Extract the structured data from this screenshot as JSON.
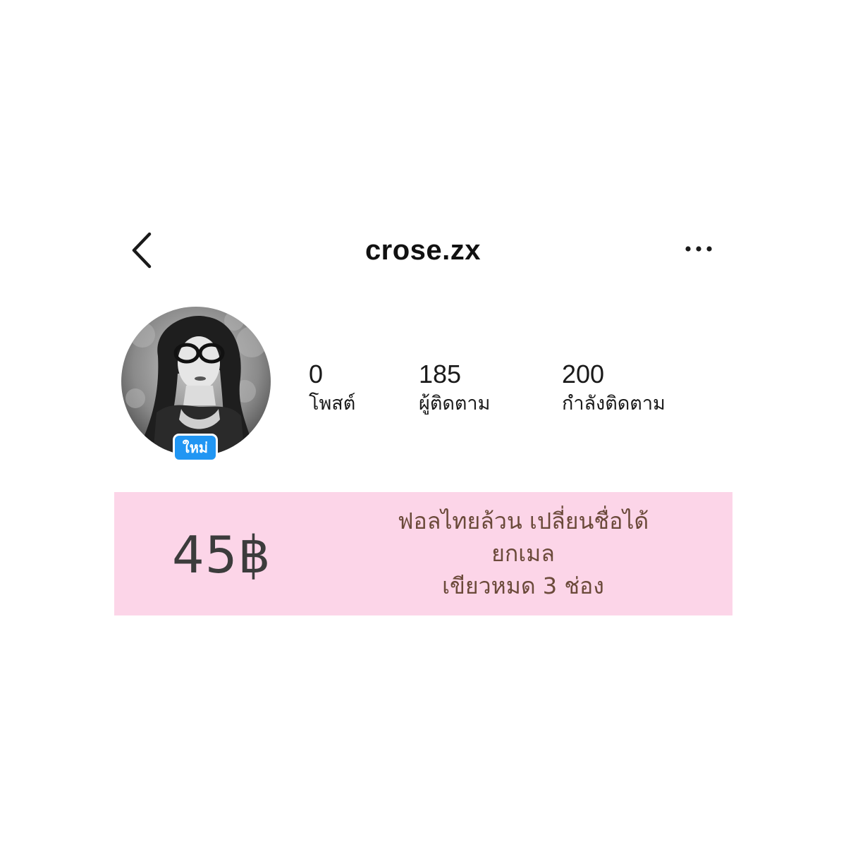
{
  "header": {
    "username": "crose.zx"
  },
  "profile": {
    "badge": "ใหม่",
    "stats": [
      {
        "value": "0",
        "label": "โพสต์"
      },
      {
        "value": "185",
        "label": "ผู้ติดตาม"
      },
      {
        "value": "200",
        "label": "กำลังติดตาม"
      }
    ]
  },
  "promo": {
    "price": "45฿",
    "lines": [
      "ฟอลไทยล้วน เปลี่ยนชื่อได้",
      "ยกเมล",
      "เขียวหมด 3 ช่อง"
    ],
    "background_color": "#fcd5e8"
  },
  "colors": {
    "badge": "#2196f3",
    "text": "#111111",
    "promo_text": "#6b4a3a"
  },
  "icons": {
    "back": "chevron-left-icon",
    "more": "more-horizontal-icon"
  }
}
